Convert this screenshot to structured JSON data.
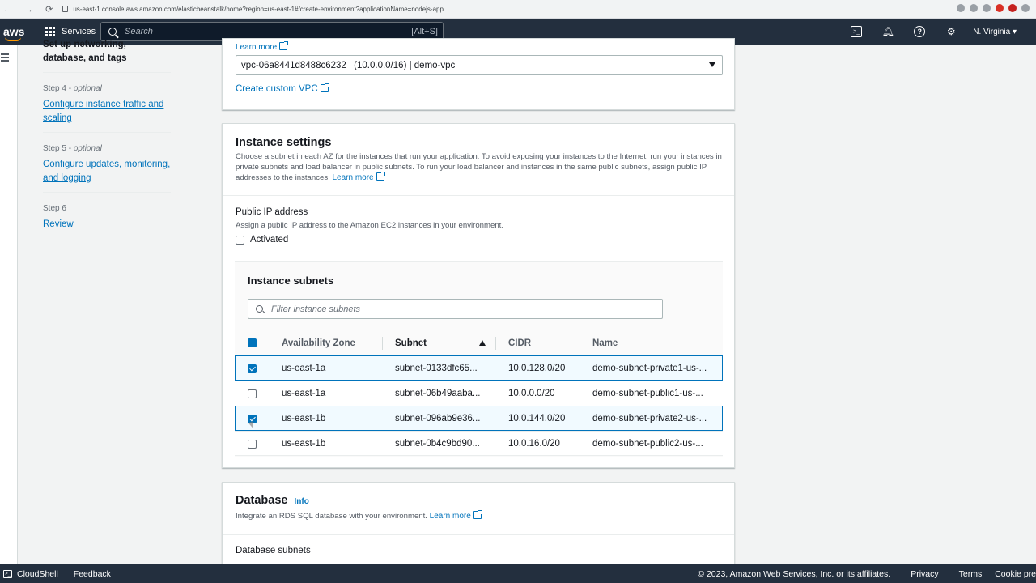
{
  "browser": {
    "url": "us-east-1.console.aws.amazon.com/elasticbeanstalk/home?region=us-east-1#/create-environment?applicationName=nodejs-app"
  },
  "topnav": {
    "logo": "aws",
    "services_label": "Services",
    "search_placeholder": "Search",
    "search_shortcut": "[Alt+S]",
    "region_label": "N. Virginia ▾"
  },
  "steps": {
    "current_heading_partial": "Set up networking, database, and tags",
    "items": [
      {
        "label": "Step 4",
        "optional": "optional",
        "link": "Configure instance traffic and scaling"
      },
      {
        "label": "Step 5",
        "optional": "optional",
        "link": "Configure updates, monitoring, and logging"
      },
      {
        "label": "Step 6",
        "optional": "",
        "link": "Review"
      }
    ]
  },
  "vpc": {
    "learn_more": "Learn more",
    "selected": "vpc-06a8441d8488c6232 | (10.0.0.0/16) | demo-vpc",
    "create_custom": "Create custom VPC"
  },
  "instance_settings": {
    "title": "Instance settings",
    "description": "Choose a subnet in each AZ for the instances that run your application. To avoid exposing your instances to the Internet, run your instances in private subnets and load balancer in public subnets. To run your load balancer and instances in the same public subnets, assign public IP addresses to the instances.",
    "learn_more": "Learn more",
    "public_ip": {
      "label": "Public IP address",
      "description": "Assign a public IP address to the Amazon EC2 instances in your environment.",
      "checkbox_label": "Activated",
      "checked": false
    },
    "subnets": {
      "title": "Instance subnets",
      "filter_placeholder": "Filter instance subnets",
      "columns": [
        "Availability Zone",
        "Subnet",
        "CIDR",
        "Name"
      ],
      "rows": [
        {
          "checked": true,
          "az": "us-east-1a",
          "subnet": "subnet-0133dfc65...",
          "cidr": "10.0.128.0/20",
          "name": "demo-subnet-private1-us-..."
        },
        {
          "checked": false,
          "az": "us-east-1a",
          "subnet": "subnet-06b49aaba...",
          "cidr": "10.0.0.0/20",
          "name": "demo-subnet-public1-us-..."
        },
        {
          "checked": true,
          "az": "us-east-1b",
          "subnet": "subnet-096ab9e36...",
          "cidr": "10.0.144.0/20",
          "name": "demo-subnet-private2-us-..."
        },
        {
          "checked": false,
          "az": "us-east-1b",
          "subnet": "subnet-0b4c9bd90...",
          "cidr": "10.0.16.0/20",
          "name": "demo-subnet-public2-us-..."
        }
      ]
    }
  },
  "database": {
    "title": "Database",
    "info": "Info",
    "description": "Integrate an RDS SQL database with your environment.",
    "learn_more": "Learn more",
    "subnets_label": "Database subnets"
  },
  "footer": {
    "cloudshell": "CloudShell",
    "feedback": "Feedback",
    "copyright": "© 2023, Amazon Web Services, Inc. or its affiliates.",
    "privacy": "Privacy",
    "terms": "Terms",
    "cookie": "Cookie pre"
  },
  "colors": {
    "nav_bg": "#232f3e",
    "link": "#0073bb",
    "accent": "#ff9900",
    "selected_row_bg": "#f1faff"
  }
}
